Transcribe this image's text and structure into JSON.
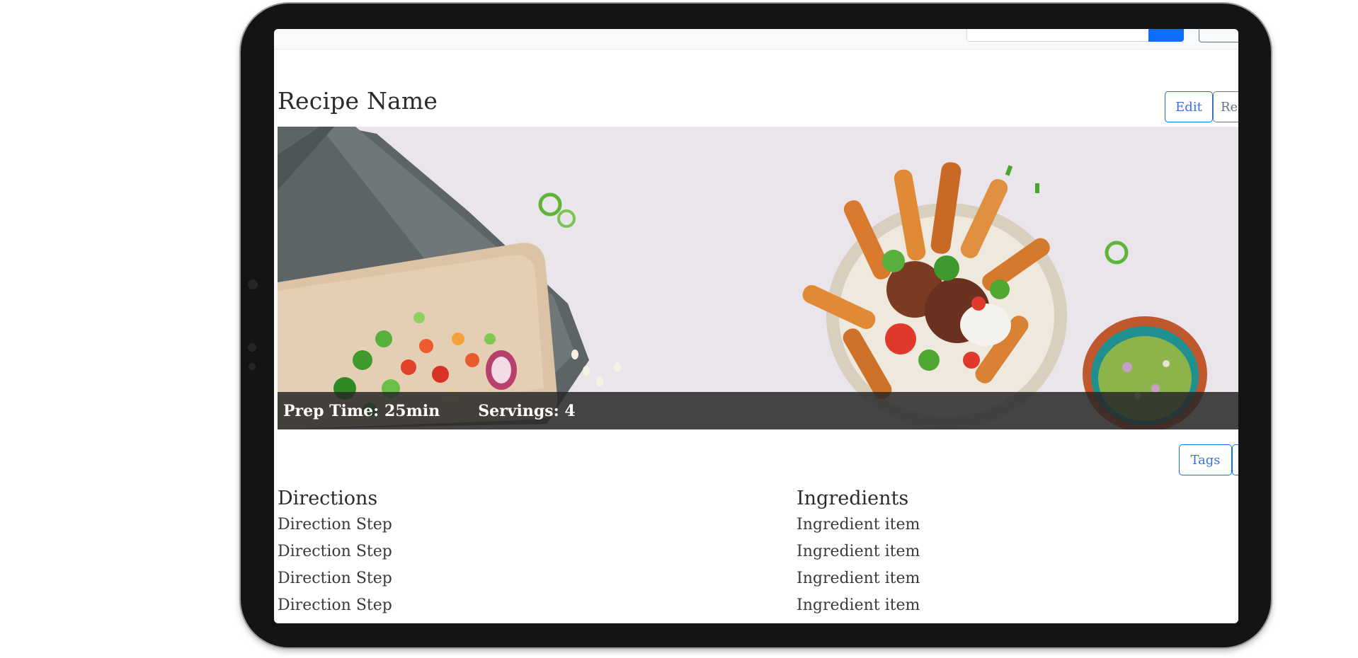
{
  "recipe": {
    "title": "Recipe Name",
    "edit_label": "Edit",
    "remove_label": "Re",
    "tags_label": "Tags",
    "prep_time": "Prep Time: 25min",
    "servings": "Servings: 4"
  },
  "directions": {
    "heading": "Directions",
    "steps": [
      "Direction Step",
      "Direction Step",
      "Direction Step",
      "Direction Step"
    ]
  },
  "ingredients": {
    "heading": "Ingredients",
    "items": [
      "Ingredient item",
      "Ingredient item",
      "Ingredient item",
      "Ingredient item"
    ]
  },
  "colors": {
    "primary": "#0d6efd",
    "secondary": "#6c757d",
    "caption_bg": "#282828",
    "frame": "#141414"
  }
}
